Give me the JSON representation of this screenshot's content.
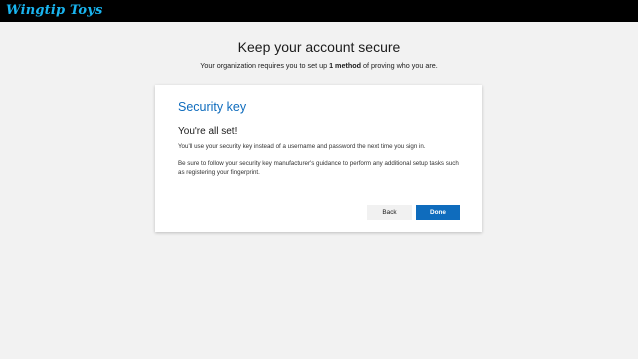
{
  "header": {
    "logo_text": "Wingtip Toys"
  },
  "page": {
    "title": "Keep your account secure",
    "subtitle_prefix": "Your organization requires you to set up ",
    "subtitle_bold": "1 method",
    "subtitle_suffix": " of proving who you are."
  },
  "card": {
    "title": "Security key",
    "subtitle": "You're all set!",
    "paragraph1": "You'll use your security key instead of a username and password the next time you sign in.",
    "paragraph2": "Be sure to follow your security key manufacturer's guidance to perform any additional setup tasks such as registering your fingerprint.",
    "back_label": "Back",
    "done_label": "Done"
  },
  "colors": {
    "accent": "#0f6cbd",
    "logo": "#19b5f0",
    "topbar": "#000000",
    "background": "#f2f2f2"
  }
}
